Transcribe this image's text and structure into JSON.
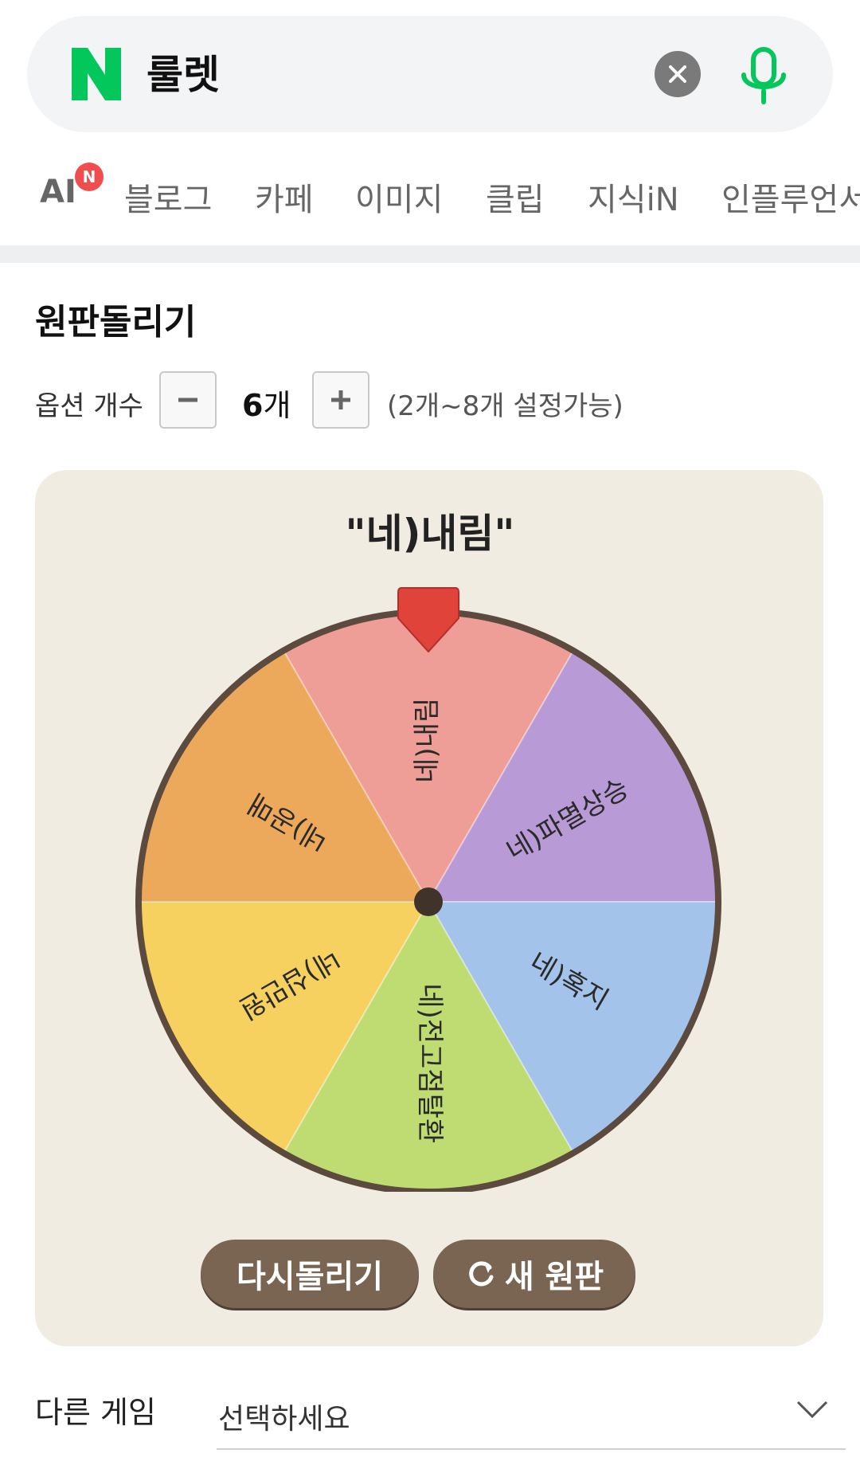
{
  "search": {
    "query": "룰렛"
  },
  "tabs": [
    {
      "label": "AI",
      "badge": "N"
    },
    {
      "label": "블로그"
    },
    {
      "label": "카페"
    },
    {
      "label": "이미지"
    },
    {
      "label": "클립"
    },
    {
      "label": "지식iN"
    },
    {
      "label": "인플루언서"
    }
  ],
  "widget": {
    "title": "원판돌리기",
    "option_label": "옵션 개수",
    "count_value": "6",
    "count_unit": "개",
    "range_note": "(2개~8개 설정가능)",
    "result": "\"네)내림\"",
    "segments": [
      {
        "label": "네)내림",
        "color": "#ee9e97"
      },
      {
        "label": "네)파멸상승",
        "color": "#b79ad6"
      },
      {
        "label": "네)혹지",
        "color": "#a3c3ea"
      },
      {
        "label": "네)전고점탈환",
        "color": "#bedc72"
      },
      {
        "label": "네)십만원",
        "color": "#f6d160"
      },
      {
        "label": "네)공매",
        "color": "#eda95b"
      }
    ],
    "respin_label": "다시돌리기",
    "new_wheel_label": "새 원판"
  },
  "other_game": {
    "label": "다른 게임",
    "placeholder": "선택하세요"
  },
  "colors": {
    "brand_green": "#03c75a",
    "pointer_red": "#e0433a",
    "button_brown": "#7a6553",
    "panel_bg": "#f1ece1"
  }
}
